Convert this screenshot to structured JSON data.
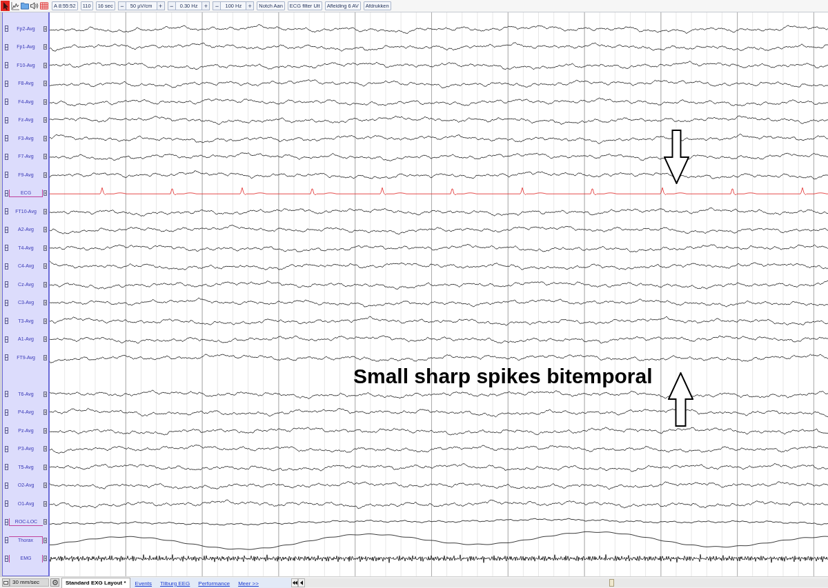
{
  "toolbar": {
    "items": [
      {
        "kind": "button",
        "label": "A 8:55:52"
      },
      {
        "kind": "button",
        "label": "110"
      },
      {
        "kind": "button",
        "label": "16 sec"
      },
      {
        "kind": "spinner",
        "minus": "−",
        "value": "50 µV/cm",
        "plus": "+"
      },
      {
        "kind": "spinner",
        "minus": "−",
        "value": "0.30 Hz",
        "plus": "+"
      },
      {
        "kind": "spinner",
        "minus": "−",
        "value": "100 Hz",
        "plus": "+"
      },
      {
        "kind": "button",
        "label": "Notch Aan"
      },
      {
        "kind": "button",
        "label": "ECG filter Uit"
      },
      {
        "kind": "button",
        "label": "Afleiding 6 AV"
      },
      {
        "kind": "button",
        "label": "Afdrukken"
      }
    ]
  },
  "channel_groups": [
    {
      "channels": [
        {
          "name": "Fp2-Avg",
          "kind": "eeg"
        },
        {
          "name": "Fp1-Avg",
          "kind": "eeg"
        },
        {
          "name": "F10-Avg",
          "kind": "eeg"
        },
        {
          "name": "F8-Avg",
          "kind": "eeg"
        },
        {
          "name": "F4-Avg",
          "kind": "eeg"
        },
        {
          "name": "Fz-Avg",
          "kind": "eeg"
        },
        {
          "name": "F3-Avg",
          "kind": "eeg"
        },
        {
          "name": "F7-Avg",
          "kind": "eeg"
        },
        {
          "name": "F9-Avg",
          "kind": "eeg"
        },
        {
          "name": "ECG",
          "kind": "ecg"
        },
        {
          "name": "FT10-Avg",
          "kind": "eeg"
        },
        {
          "name": "A2-Avg",
          "kind": "eeg"
        },
        {
          "name": "T4-Avg",
          "kind": "eeg"
        },
        {
          "name": "C4-Avg",
          "kind": "eeg"
        },
        {
          "name": "Cz-Avg",
          "kind": "eeg"
        },
        {
          "name": "C3-Avg",
          "kind": "eeg"
        },
        {
          "name": "T3-Avg",
          "kind": "eeg"
        },
        {
          "name": "A1-Avg",
          "kind": "eeg"
        },
        {
          "name": "FT9-Avg",
          "kind": "eeg"
        }
      ]
    },
    {
      "channels": [
        {
          "name": "T6-Avg",
          "kind": "eeg"
        },
        {
          "name": "P4-Avg",
          "kind": "eeg"
        },
        {
          "name": "Pz-Avg",
          "kind": "eeg"
        },
        {
          "name": "P3-Avg",
          "kind": "eeg"
        },
        {
          "name": "T5-Avg",
          "kind": "eeg"
        },
        {
          "name": "O2-Avg",
          "kind": "eeg"
        },
        {
          "name": "O1-Avg",
          "kind": "eeg"
        },
        {
          "name": "ROC-LOC",
          "kind": "eog"
        },
        {
          "name": "Thorax",
          "kind": "resp"
        },
        {
          "name": "EMG",
          "kind": "emg"
        }
      ]
    }
  ],
  "annotation": {
    "text": "Small sharp spikes bitemporal"
  },
  "bottom_bar": {
    "speed": "30 mm/sec",
    "tabs": [
      {
        "label": "Standard EXG Layout *",
        "selected": true
      },
      {
        "label": "Events",
        "selected": false
      },
      {
        "label": "Tilburg EEG",
        "selected": false
      },
      {
        "label": "Performance",
        "selected": false
      },
      {
        "label": "Meer >>",
        "selected": false
      }
    ]
  }
}
